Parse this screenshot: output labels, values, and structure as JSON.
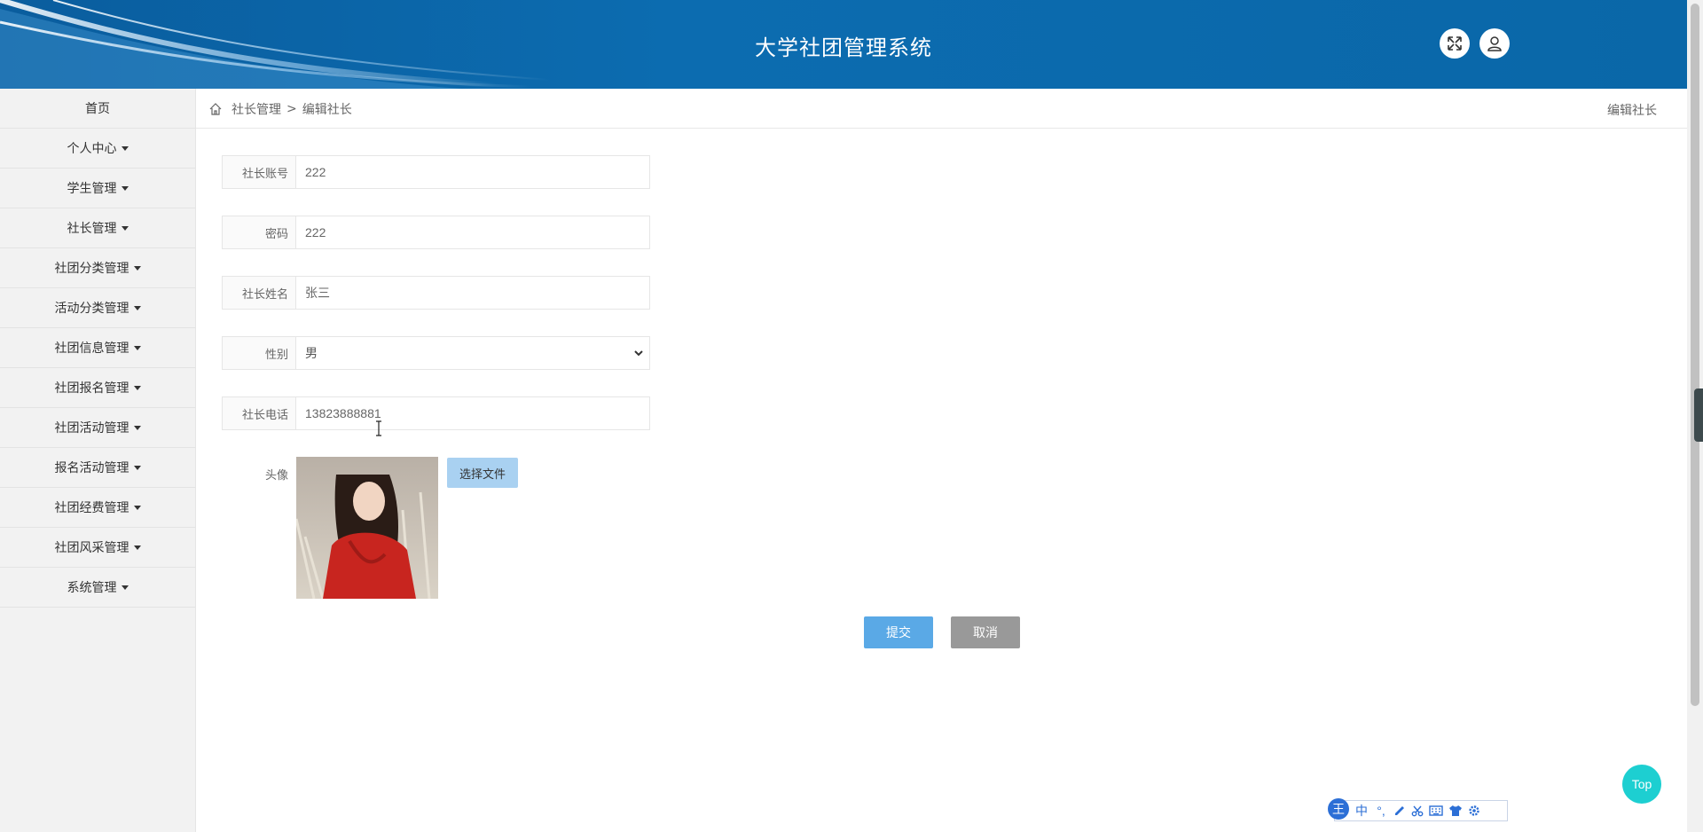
{
  "header": {
    "title": "大学社团管理系统"
  },
  "sidebar": {
    "items": [
      {
        "label": "首页",
        "has_caret": false
      },
      {
        "label": "个人中心",
        "has_caret": true
      },
      {
        "label": "学生管理",
        "has_caret": true
      },
      {
        "label": "社长管理",
        "has_caret": true
      },
      {
        "label": "社团分类管理",
        "has_caret": true
      },
      {
        "label": "活动分类管理",
        "has_caret": true
      },
      {
        "label": "社团信息管理",
        "has_caret": true
      },
      {
        "label": "社团报名管理",
        "has_caret": true
      },
      {
        "label": "社团活动管理",
        "has_caret": true
      },
      {
        "label": "报名活动管理",
        "has_caret": true
      },
      {
        "label": "社团经费管理",
        "has_caret": true
      },
      {
        "label": "社团风采管理",
        "has_caret": true
      },
      {
        "label": "系统管理",
        "has_caret": true
      }
    ]
  },
  "breadcrumb": {
    "parent": "社长管理",
    "separator": ">",
    "current": "编辑社长",
    "right_title": "编辑社长"
  },
  "form": {
    "account": {
      "label": "社长账号",
      "value": "222"
    },
    "password": {
      "label": "密码",
      "value": "222"
    },
    "name": {
      "label": "社长姓名",
      "value": "张三"
    },
    "gender": {
      "label": "性别",
      "value": "男"
    },
    "phone": {
      "label": "社长电话",
      "value": "13823888881"
    },
    "avatar": {
      "label": "头像",
      "button_label": "选择文件"
    }
  },
  "actions": {
    "submit_label": "提交",
    "cancel_label": "取消"
  },
  "top_button": {
    "label": "Top"
  },
  "ime_toolbar": {
    "logo": "王",
    "mode": "中",
    "punct": "°,"
  },
  "colors": {
    "header": "#0c6cb0",
    "submit": "#5aa9e6",
    "cancel": "#999999",
    "top": "#1dcfd1",
    "file_button": "#a9d1f1"
  }
}
